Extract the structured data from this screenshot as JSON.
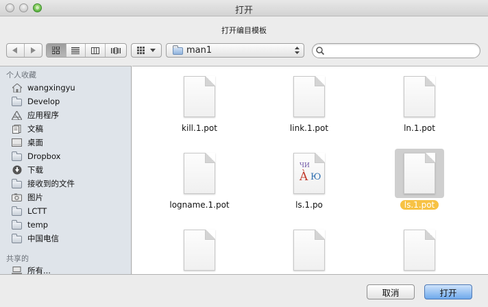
{
  "window": {
    "title": "打开"
  },
  "prompt": "打开编目模板",
  "toolbar": {
    "path_popup": "man1",
    "search_placeholder": ""
  },
  "sidebar": {
    "favorites_header": "个人收藏",
    "favorites": [
      {
        "label": "wangxingyu",
        "icon": "home-icon"
      },
      {
        "label": "Develop",
        "icon": "folder-icon"
      },
      {
        "label": "应用程序",
        "icon": "applications-icon"
      },
      {
        "label": "文稿",
        "icon": "documents-icon"
      },
      {
        "label": "桌面",
        "icon": "desktop-icon"
      },
      {
        "label": "Dropbox",
        "icon": "folder-icon"
      },
      {
        "label": "下载",
        "icon": "downloads-icon"
      },
      {
        "label": "接收到的文件",
        "icon": "folder-icon"
      },
      {
        "label": "图片",
        "icon": "pictures-icon"
      },
      {
        "label": "LCTT",
        "icon": "folder-icon"
      },
      {
        "label": "temp",
        "icon": "folder-icon"
      },
      {
        "label": "中国电信",
        "icon": "folder-icon"
      }
    ],
    "shared_header": "共享的",
    "shared": [
      {
        "label": "所有...",
        "icon": "network-icon"
      }
    ]
  },
  "files": [
    {
      "name": "kill.1.pot"
    },
    {
      "name": "link.1.pot"
    },
    {
      "name": "ln.1.pot"
    },
    {
      "name": "logname.1.pot"
    },
    {
      "name": "ls.1.po",
      "glyph_top": "ЧИ",
      "glyph_left": "À",
      "glyph_right": "Ю"
    },
    {
      "name": "ls.1.pot"
    },
    {
      "name": ""
    },
    {
      "name": ""
    },
    {
      "name": ""
    }
  ],
  "buttons": {
    "cancel": "取消",
    "open": "打开"
  }
}
